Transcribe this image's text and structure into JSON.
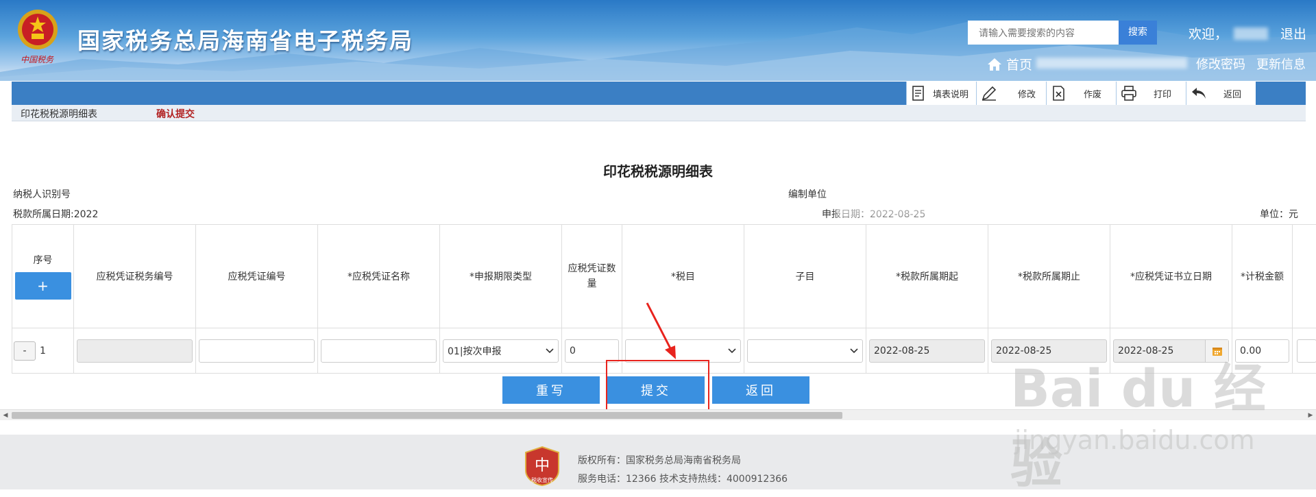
{
  "header": {
    "title": "国家税务总局海南省电子税务局",
    "brand_sub": "中国税务",
    "search_placeholder": "请输入需要搜索的内容",
    "search_label": "搜索",
    "welcome": "欢迎，",
    "logout": "退出",
    "nav_home": "首页",
    "nav_change_password": "修改密码",
    "nav_update_info": "更新信息"
  },
  "toolbar": {
    "fill_help": "填表说明",
    "modify": "修改",
    "void": "作废",
    "print": "打印",
    "back": "返回"
  },
  "breadcrumb": {
    "step1": "印花税税源明细表",
    "step2": "确认提交"
  },
  "form": {
    "title": "印花税税源明细表",
    "taxpayer_id_label": "纳税人识别号",
    "compiler_label": "编制单位",
    "tax_period_label": "税款所属日期:2022",
    "declare_date_label": "申报日期：2022-08-25",
    "unit_label": "单位：元"
  },
  "table": {
    "columns": [
      "序号",
      "应税凭证税务编号",
      "应税凭证编号",
      "*应税凭证名称",
      "*申报期限类型",
      "应税凭证数量",
      "*税目",
      "子目",
      "*税款所属期起",
      "*税款所属期止",
      "*应税凭证书立日期",
      "*计税金额"
    ],
    "add_label": "+",
    "remove_label": "-",
    "row": {
      "index": "1",
      "tax_no": "",
      "voucher_no": "",
      "voucher_name": "",
      "period_type": "01|按次申报",
      "quantity": "0",
      "tax_item": "",
      "sub_item": "",
      "period_start": "2022-08-25",
      "period_end": "2022-08-25",
      "issue_date": "2022-08-25",
      "amount": "0.00"
    }
  },
  "actions": {
    "rewrite": "重写",
    "submit": "提交",
    "back": "返回"
  },
  "footer": {
    "badge": "税收宣传",
    "copyright": "版权所有：国家税务总局海南省税务局",
    "service": "服务电话：12366 技术支持热线：4000912366"
  },
  "watermark": {
    "main": "Bai du 经验",
    "sub": "jingyan.baidu.com"
  },
  "colors": {
    "header_blue": "#2a79c6",
    "toolbar_blue": "#3b7fc4",
    "button_blue": "#3a90e0",
    "highlight_red": "#e8231d"
  }
}
